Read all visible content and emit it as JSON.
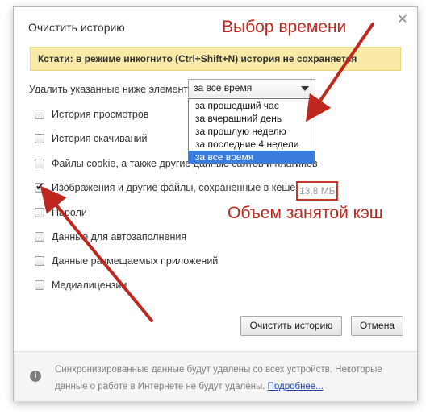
{
  "dialog": {
    "title": "Очистить историю",
    "close_glyph": "✕",
    "notice": "Кстати: в режиме инкогнито (Ctrl+Shift+N) история не сохраняется",
    "range_label": "Удалить указанные ниже элементы",
    "selected_range": "за все время",
    "range_options": [
      "за прошедший час",
      "за вчерашний день",
      "за прошлую неделю",
      "за последние 4 недели",
      "за все время"
    ],
    "items": [
      {
        "label": "История просмотров",
        "checked": false
      },
      {
        "label": "История скачиваний",
        "checked": false
      },
      {
        "label": "Файлы cookie, а также другие данные сайтов и плагинов",
        "checked": false
      },
      {
        "label": "Изображения и другие файлы, сохраненные в кеше –",
        "checked": true
      },
      {
        "label": "Пароли",
        "checked": false
      },
      {
        "label": "Данные для автозаполнения",
        "checked": false
      },
      {
        "label": "Данные размещаемых приложений",
        "checked": false
      },
      {
        "label": "Медиалицензии",
        "checked": false
      }
    ],
    "cache_size": "13,8 МБ",
    "clear_button": "Очистить историю",
    "cancel_button": "Отмена",
    "footer_text": "Синхронизированные данные будут удалены со всех устройств. Некоторые данные о работе в Интернете не будут удалены.",
    "footer_link": "Подробнее..."
  },
  "annotations": {
    "time_choice": "Выбор времени",
    "cache_used": "Объем занятой кэш"
  },
  "icons": {
    "info": "info-icon",
    "close": "close-icon",
    "caret": "chevron-down-icon",
    "check": "check-icon"
  },
  "colors": {
    "notice_bg": "#f9eaa8",
    "selected_option": "#3b7ddd",
    "annotation_red": "#c0281f",
    "link": "#1a3fa0"
  }
}
